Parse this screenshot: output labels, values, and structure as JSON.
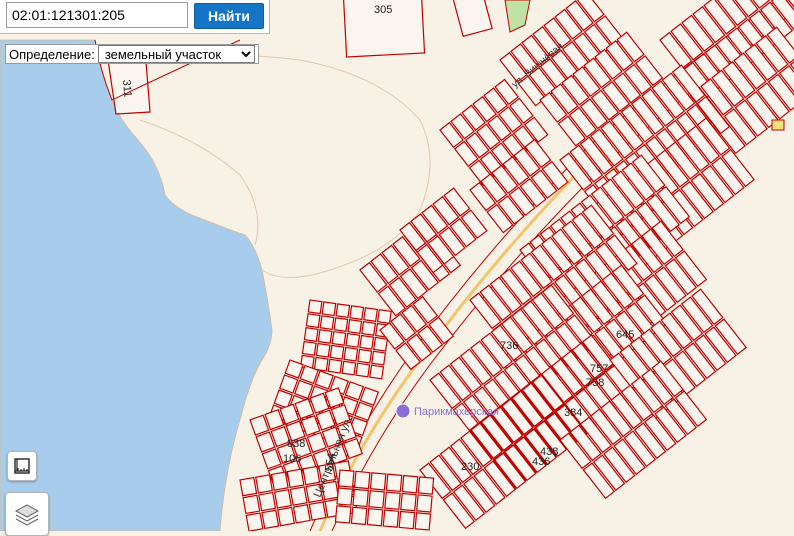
{
  "search": {
    "value": "02:01:121301:205",
    "button_label": "Найти"
  },
  "definition": {
    "label": "Определение:",
    "selected": "земельный участок"
  },
  "map_labels": {
    "parcel_305": "305",
    "parcel_311": "311",
    "parcel_736": "736",
    "parcel_645": "645",
    "parcel_757": "757",
    "parcel_758": "758",
    "parcel_384": "384",
    "parcel_438": "438",
    "parcel_436": "436",
    "parcel_230": "230",
    "parcel_838": "838",
    "parcel_106": "106",
    "parcel_554": "554",
    "street_central": "Центральная ул.",
    "street_vishnevaya": "ул. Вишнёвая",
    "poi_hairdresser": "Парикмахерская"
  },
  "colors": {
    "water": "#a8cdec",
    "land": "#f7f1e6",
    "parcel": "#c00000",
    "road": "#f2c56b",
    "accent": "#1475c6"
  },
  "icons": {
    "measure": "ruler-icon",
    "layers": "layers-icon",
    "poi": "scissors-icon"
  }
}
